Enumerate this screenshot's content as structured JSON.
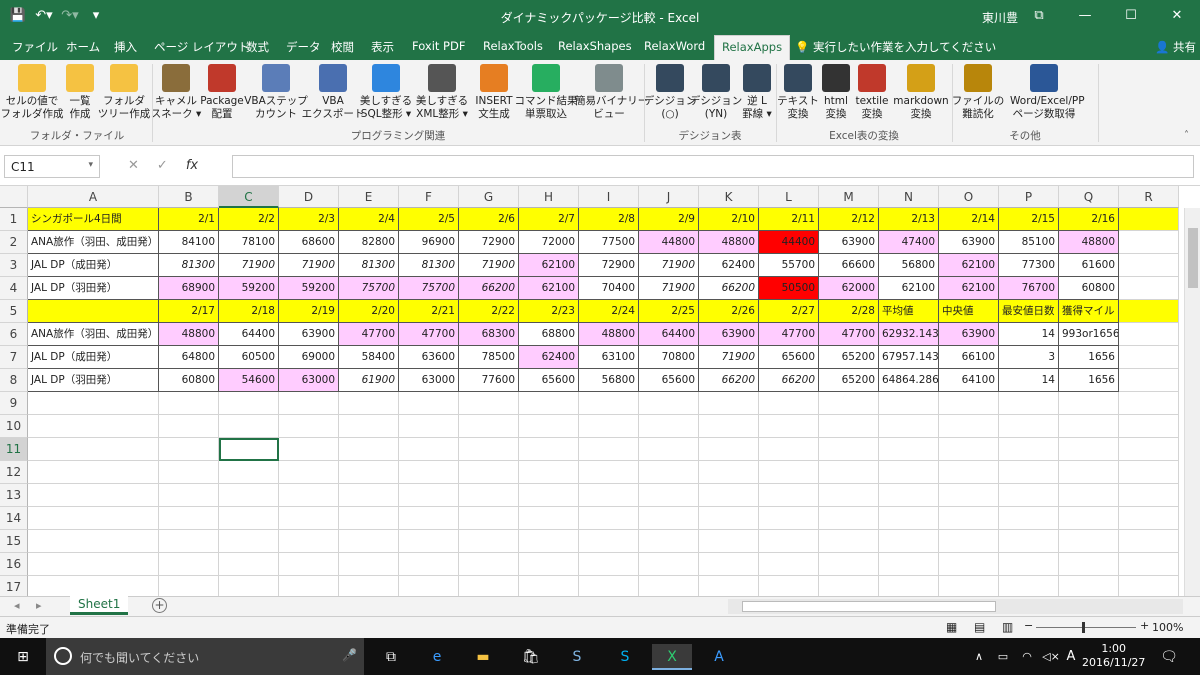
{
  "window": {
    "title": "ダイナミックパッケージ比較 - Excel",
    "user": "東川豊"
  },
  "tabs": [
    "ファイル",
    "ホーム",
    "挿入",
    "ページ レイアウト",
    "数式",
    "データ",
    "校閲",
    "表示",
    "Foxit PDF",
    "RelaxTools",
    "RelaxShapes",
    "RelaxWord",
    "RelaxApps"
  ],
  "active_tab": "RelaxApps",
  "tell_me": "実行したい作業を入力してください",
  "share": "共有",
  "ribbon": {
    "buttons": [
      {
        "l1": "セルの値で",
        "l2": "フォルダ作成",
        "icon": "folder-icon",
        "color": "#f5c242"
      },
      {
        "l1": "一覧",
        "l2": "作成",
        "icon": "folder-list-icon",
        "color": "#f5c242"
      },
      {
        "l1": "フォルダ",
        "l2": "ツリー作成",
        "icon": "folder-tree-icon",
        "color": "#f5c242"
      },
      {
        "l1": "キャメル",
        "l2": "スネーク ▾",
        "icon": "camel-snake-icon",
        "color": "#8a6d3b"
      },
      {
        "l1": "Package",
        "l2": "配置",
        "icon": "java-icon",
        "color": "#c0392b"
      },
      {
        "l1": "VBAステップ",
        "l2": "カウント",
        "icon": "vba-step-icon",
        "color": "#5b7db8"
      },
      {
        "l1": "VBA",
        "l2": "エクスポート",
        "icon": "vba-export-icon",
        "color": "#4a6fb0"
      },
      {
        "l1": "美しすぎる",
        "l2": "SQL整形 ▾",
        "icon": "sql-icon",
        "color": "#2e86de"
      },
      {
        "l1": "美しすぎる",
        "l2": "XML整形 ▾",
        "icon": "xml-icon",
        "color": "#555555"
      },
      {
        "l1": "INSERT",
        "l2": "文生成",
        "icon": "insert-icon",
        "color": "#e67e22"
      },
      {
        "l1": "コマンド結果",
        "l2": "単票取込",
        "icon": "command-result-icon",
        "color": "#27ae60"
      },
      {
        "l1": "簡易バイナリー",
        "l2": "ビュー",
        "icon": "binary-view-icon",
        "color": "#7f8c8d"
      },
      {
        "l1": "デシジョン",
        "l2": "(○)",
        "icon": "decision-circle-icon",
        "color": "#34495e"
      },
      {
        "l1": "デシジョン",
        "l2": "(YN)",
        "icon": "decision-yn-icon",
        "color": "#34495e"
      },
      {
        "l1": "逆 L",
        "l2": "罫線 ▾",
        "icon": "reverse-l-border-icon",
        "color": "#34495e"
      },
      {
        "l1": "テキスト",
        "l2": "変換",
        "icon": "text-convert-icon",
        "color": "#34495e"
      },
      {
        "l1": "html",
        "l2": "変換",
        "icon": "html-icon",
        "color": "#333333"
      },
      {
        "l1": "textile",
        "l2": "変換",
        "icon": "textile-icon",
        "color": "#c0392b"
      },
      {
        "l1": "markdown",
        "l2": "変換",
        "icon": "markdown-icon",
        "color": "#d4a017"
      },
      {
        "l1": "ファイルの",
        "l2": "難読化",
        "icon": "file-lock-icon",
        "color": "#b8860b"
      },
      {
        "l1": "Word/Excel/PP",
        "l2": "ページ数取得",
        "icon": "office-pages-icon",
        "color": "#2b5797"
      }
    ],
    "groups": [
      "フォルダ・ファイル",
      "プログラミング関連",
      "デシジョン表",
      "Excel表の変換",
      "その他"
    ]
  },
  "formula_bar": {
    "name_box": "C11",
    "formula": ""
  },
  "columns": [
    "A",
    "B",
    "C",
    "D",
    "E",
    "F",
    "G",
    "H",
    "I",
    "J",
    "K",
    "L",
    "M",
    "N",
    "O",
    "P",
    "Q",
    "R"
  ],
  "active_col": "C",
  "active_row": "11",
  "row_numbers": [
    "1",
    "2",
    "3",
    "4",
    "5",
    "6",
    "7",
    "8",
    "9",
    "10",
    "11",
    "12",
    "13",
    "14",
    "15",
    "16",
    "17"
  ],
  "table": [
    [
      {
        "v": "シンガポール4日間",
        "f": "y"
      },
      {
        "v": "2/1",
        "f": "y"
      },
      {
        "v": "2/2",
        "f": "y"
      },
      {
        "v": "2/3",
        "f": "y"
      },
      {
        "v": "2/4",
        "f": "y"
      },
      {
        "v": "2/5",
        "f": "y"
      },
      {
        "v": "2/6",
        "f": "y"
      },
      {
        "v": "2/7",
        "f": "y"
      },
      {
        "v": "2/8",
        "f": "y"
      },
      {
        "v": "2/9",
        "f": "y"
      },
      {
        "v": "2/10",
        "f": "y"
      },
      {
        "v": "2/11",
        "f": "y"
      },
      {
        "v": "2/12",
        "f": "y"
      },
      {
        "v": "2/13",
        "f": "y"
      },
      {
        "v": "2/14",
        "f": "y"
      },
      {
        "v": "2/15",
        "f": "y"
      },
      {
        "v": "2/16",
        "f": "y"
      },
      {
        "v": "",
        "f": "y"
      }
    ],
    [
      {
        "v": "ANA旅作（羽田、成田発）"
      },
      {
        "v": "84100"
      },
      {
        "v": "78100"
      },
      {
        "v": "68600"
      },
      {
        "v": "82800"
      },
      {
        "v": "96900"
      },
      {
        "v": "72900"
      },
      {
        "v": "72000"
      },
      {
        "v": "77500"
      },
      {
        "v": "44800",
        "f": "p"
      },
      {
        "v": "48800",
        "f": "p"
      },
      {
        "v": "44400",
        "f": "red"
      },
      {
        "v": "63900"
      },
      {
        "v": "47400",
        "f": "p"
      },
      {
        "v": "63900"
      },
      {
        "v": "85100"
      },
      {
        "v": "48800",
        "f": "p"
      },
      {
        "v": ""
      }
    ],
    [
      {
        "v": "JAL DP（成田発）"
      },
      {
        "v": "81300",
        "f": "i"
      },
      {
        "v": "71900",
        "f": "i"
      },
      {
        "v": "71900",
        "f": "i"
      },
      {
        "v": "81300",
        "f": "i"
      },
      {
        "v": "81300",
        "f": "i"
      },
      {
        "v": "71900",
        "f": "i"
      },
      {
        "v": "62100",
        "f": "p"
      },
      {
        "v": "72900"
      },
      {
        "v": "71900",
        "f": "i"
      },
      {
        "v": "62400"
      },
      {
        "v": "55700"
      },
      {
        "v": "66600"
      },
      {
        "v": "56800"
      },
      {
        "v": "62100",
        "f": "p"
      },
      {
        "v": "77300"
      },
      {
        "v": "61600"
      },
      {
        "v": ""
      }
    ],
    [
      {
        "v": "JAL DP（羽田発）"
      },
      {
        "v": "68900",
        "f": "p"
      },
      {
        "v": "59200",
        "f": "p"
      },
      {
        "v": "59200",
        "f": "p"
      },
      {
        "v": "75700",
        "f": "pi"
      },
      {
        "v": "75700",
        "f": "pi"
      },
      {
        "v": "66200",
        "f": "pi"
      },
      {
        "v": "62100",
        "f": "p"
      },
      {
        "v": "70400"
      },
      {
        "v": "71900",
        "f": "i"
      },
      {
        "v": "66200",
        "f": "i"
      },
      {
        "v": "50500",
        "f": "red"
      },
      {
        "v": "62000",
        "f": "p"
      },
      {
        "v": "62100"
      },
      {
        "v": "62100",
        "f": "p"
      },
      {
        "v": "76700",
        "f": "p"
      },
      {
        "v": "60800"
      },
      {
        "v": ""
      }
    ],
    [
      {
        "v": "",
        "f": "y"
      },
      {
        "v": "2/17",
        "f": "y"
      },
      {
        "v": "2/18",
        "f": "y"
      },
      {
        "v": "2/19",
        "f": "y"
      },
      {
        "v": "2/20",
        "f": "y"
      },
      {
        "v": "2/21",
        "f": "y"
      },
      {
        "v": "2/22",
        "f": "y"
      },
      {
        "v": "2/23",
        "f": "y"
      },
      {
        "v": "2/24",
        "f": "y"
      },
      {
        "v": "2/25",
        "f": "y"
      },
      {
        "v": "2/26",
        "f": "y"
      },
      {
        "v": "2/27",
        "f": "y"
      },
      {
        "v": "2/28",
        "f": "y"
      },
      {
        "v": "平均値",
        "f": "yl"
      },
      {
        "v": "中央値",
        "f": "yl"
      },
      {
        "v": "最安値日数",
        "f": "yl"
      },
      {
        "v": "獲得マイル",
        "f": "yl"
      },
      {
        "v": "",
        "f": "y"
      }
    ],
    [
      {
        "v": "ANA旅作（羽田、成田発）"
      },
      {
        "v": "48800",
        "f": "p"
      },
      {
        "v": "64400"
      },
      {
        "v": "63900"
      },
      {
        "v": "47700",
        "f": "p"
      },
      {
        "v": "47700",
        "f": "p"
      },
      {
        "v": "68300",
        "f": "p"
      },
      {
        "v": "68800"
      },
      {
        "v": "48800",
        "f": "p"
      },
      {
        "v": "64400",
        "f": "p"
      },
      {
        "v": "63900",
        "f": "p"
      },
      {
        "v": "47700",
        "f": "p"
      },
      {
        "v": "47700",
        "f": "p"
      },
      {
        "v": "62932.143",
        "f": "p"
      },
      {
        "v": "63900",
        "f": "p"
      },
      {
        "v": "14"
      },
      {
        "v": "993or1656"
      },
      {
        "v": ""
      }
    ],
    [
      {
        "v": "JAL DP（成田発）"
      },
      {
        "v": "64800"
      },
      {
        "v": "60500"
      },
      {
        "v": "69000"
      },
      {
        "v": "58400"
      },
      {
        "v": "63600"
      },
      {
        "v": "78500"
      },
      {
        "v": "62400",
        "f": "p"
      },
      {
        "v": "63100"
      },
      {
        "v": "70800"
      },
      {
        "v": "71900",
        "f": "i"
      },
      {
        "v": "65600"
      },
      {
        "v": "65200"
      },
      {
        "v": "67957.143"
      },
      {
        "v": "66100"
      },
      {
        "v": "3"
      },
      {
        "v": "1656"
      },
      {
        "v": ""
      }
    ],
    [
      {
        "v": "JAL DP（羽田発）"
      },
      {
        "v": "60800"
      },
      {
        "v": "54600",
        "f": "p"
      },
      {
        "v": "63000",
        "f": "p"
      },
      {
        "v": "61900",
        "f": "i"
      },
      {
        "v": "63000"
      },
      {
        "v": "77600"
      },
      {
        "v": "65600"
      },
      {
        "v": "56800"
      },
      {
        "v": "65600"
      },
      {
        "v": "66200",
        "f": "i"
      },
      {
        "v": "66200",
        "f": "i"
      },
      {
        "v": "65200"
      },
      {
        "v": "64864.286"
      },
      {
        "v": "64100"
      },
      {
        "v": "14"
      },
      {
        "v": "1656"
      },
      {
        "v": ""
      }
    ]
  ],
  "sheet_tab": "Sheet1",
  "status": {
    "text": "準備完了",
    "zoom": "100%"
  },
  "taskbar": {
    "search": "何でも聞いてください",
    "time": "1:00",
    "date": "2016/11/27",
    "ime": "A"
  }
}
